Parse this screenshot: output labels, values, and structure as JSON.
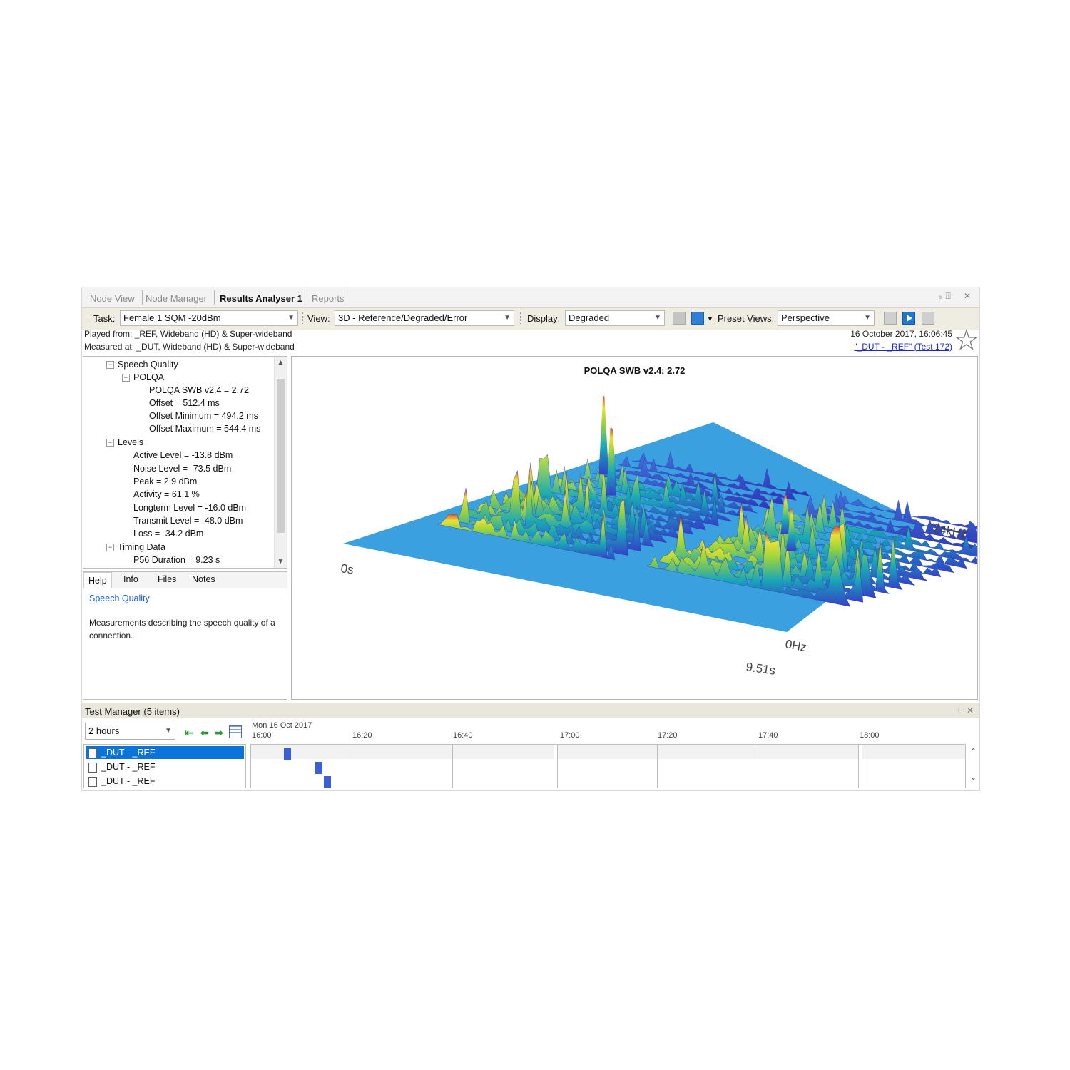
{
  "tabs": [
    "Node View",
    "Node Manager",
    "Results Analyser 1",
    "Reports"
  ],
  "window_controls": {
    "pin": "⍚ ⍐",
    "close": "✕"
  },
  "toolbar": {
    "task_label": "Task:",
    "task_value": "Female 1 SQM -20dBm",
    "view_label": "View:",
    "view_value": "3D - Reference/Degraded/Error",
    "display_label": "Display:",
    "display_value": "Degraded",
    "preset_label": "Preset Views:",
    "preset_value": "Perspective"
  },
  "info": {
    "played_from": "Played from: _REF, Wideband (HD) & Super-wideband",
    "measured_at": "Measured at: _DUT, Wideband (HD) & Super-wideband",
    "timestamp": "16 October 2017, 16:06:45",
    "test_link": "\"_DUT - _REF\" (Test 172)"
  },
  "tree": [
    {
      "label": "Speech Quality",
      "toggle": "−"
    },
    {
      "label": "POLQA",
      "toggle": "−"
    },
    {
      "label": "POLQA SWB v2.4 = 2.72"
    },
    {
      "label": "Offset = 512.4 ms"
    },
    {
      "label": "Offset Minimum = 494.2 ms"
    },
    {
      "label": "Offset Maximum = 544.4 ms"
    },
    {
      "label": "Levels",
      "toggle": "−"
    },
    {
      "label": "Active Level = -13.8 dBm"
    },
    {
      "label": "Noise Level = -73.5 dBm"
    },
    {
      "label": "Peak = 2.9 dBm"
    },
    {
      "label": "Activity = 61.1 %"
    },
    {
      "label": "Longterm Level = -16.0 dBm"
    },
    {
      "label": "Transmit Level = -48.0 dBm"
    },
    {
      "label": "Loss = -34.2 dBm"
    },
    {
      "label": "Timing Data",
      "toggle": "−"
    },
    {
      "label": "P56 Duration = 9.23 s"
    }
  ],
  "help": {
    "tabs": [
      "Help",
      "Info",
      "Files",
      "Notes"
    ],
    "title": "Speech Quality",
    "body": "Measurements describing the speech quality of a connection."
  },
  "chart": {
    "title": "POLQA SWB v2.4: 2.72",
    "axis_time_start": "0s",
    "axis_time_end": "9.51s",
    "axis_freq_start": "0Hz",
    "axis_freq_end": "24kHz",
    "colors": {
      "floor": "#3aa0e0",
      "low": "#3340c8",
      "mid": "#16b3b0",
      "high": "#e7e03a",
      "peak": "#e0402a"
    }
  },
  "test_manager": {
    "title": "Test Manager (5 items)",
    "range": "2 hours",
    "date_label": "Mon 16 Oct 2017",
    "ticks": [
      "16:00",
      "16:20",
      "16:40",
      "17:00",
      "17:20",
      "17:40",
      "18:00"
    ],
    "items": [
      "_DUT - _REF",
      "_DUT - _REF",
      "_DUT - _REF"
    ]
  }
}
